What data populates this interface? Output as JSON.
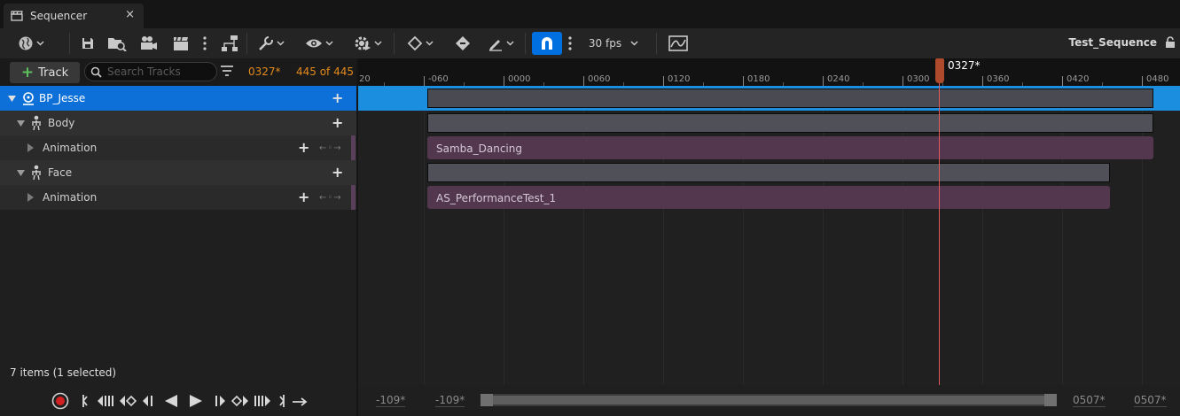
{
  "tab": {
    "title": "Sequencer",
    "close": "×"
  },
  "toolbar": {
    "fps": "30 fps",
    "sequence_name": "Test_Sequence",
    "accent_color": "#0070e0"
  },
  "tracks_header": {
    "add_track_label": "Track",
    "search_placeholder": "Search Tracks",
    "current_time": "0327*",
    "count": "445 of 445"
  },
  "tracks": [
    {
      "label": "BP_Jesse",
      "icon": "actor-icon",
      "selected": true
    },
    {
      "label": "Body",
      "icon": "skeletal-mesh-icon"
    },
    {
      "label": "Animation",
      "icon": "none"
    },
    {
      "label": "Face",
      "icon": "skeletal-mesh-icon"
    },
    {
      "label": "Animation",
      "icon": "none"
    }
  ],
  "status": "7 items (1 selected)",
  "ruler_ticks": [
    "20",
    "-060",
    "0000",
    "0060",
    "0120",
    "0180",
    "0240",
    "0300",
    "0360",
    "0420",
    "0480"
  ],
  "sections": {
    "body_anim": "Samba_Dancing",
    "face_anim": "AS_PerformanceTest_1"
  },
  "playhead": {
    "label": "0327*",
    "color": "#e45a5a"
  },
  "range": {
    "view_start_outer": "-109*",
    "view_start_inner": "-109*",
    "view_end_inner": "0507*",
    "view_end_outer": "0507*"
  }
}
